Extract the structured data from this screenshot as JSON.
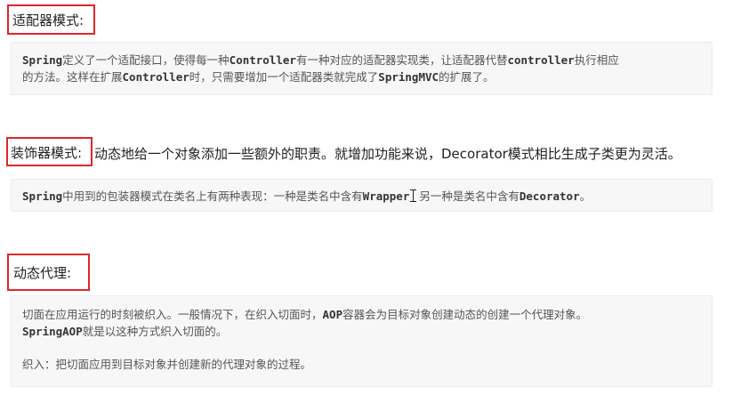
{
  "section1": {
    "heading": "适配器模式:",
    "lines": [
      {
        "p1": "Spring",
        "p2": "定义了一个适配接口，使得每一种",
        "p3": "Controller",
        "p4": "有一种对应的适配器实现类，让适配器代替",
        "p5": "controller",
        "p6": "执行相应"
      },
      {
        "p1": "的方法。这样在扩展",
        "p2": "Controller",
        "p3": "时，只需要增加一个适配器类就完成了",
        "p4": "SpringMVC",
        "p5": "的扩展了。"
      }
    ]
  },
  "section2": {
    "heading": "装饰器模式:",
    "heading_desc": "动态地给一个对象添加一些额外的职责。就增加功能来说，Decorator模式相比生成子类更为灵活。",
    "line": {
      "p1": "Spring",
      "p2": "中用到的包装器模式在类名上有两种表现：一种是类名中含有",
      "p3": "Wrapper",
      "p4": "另一种是类名中含有",
      "p5": "Decorator",
      "p6": "。"
    }
  },
  "section3": {
    "heading": "动态代理:",
    "line1": {
      "p1": "切面在应用运行的时刻被织入。一般情况下，在织入切面时，",
      "p2": "AOP",
      "p3": "容器会为目标对象创建动态的创建一个代理对象。"
    },
    "line2": {
      "p1": "SpringAOP",
      "p2": "就是以这种方式织入切面的。"
    },
    "line3": "织入：把切面应用到目标对象并创建新的代理对象的过程。"
  }
}
